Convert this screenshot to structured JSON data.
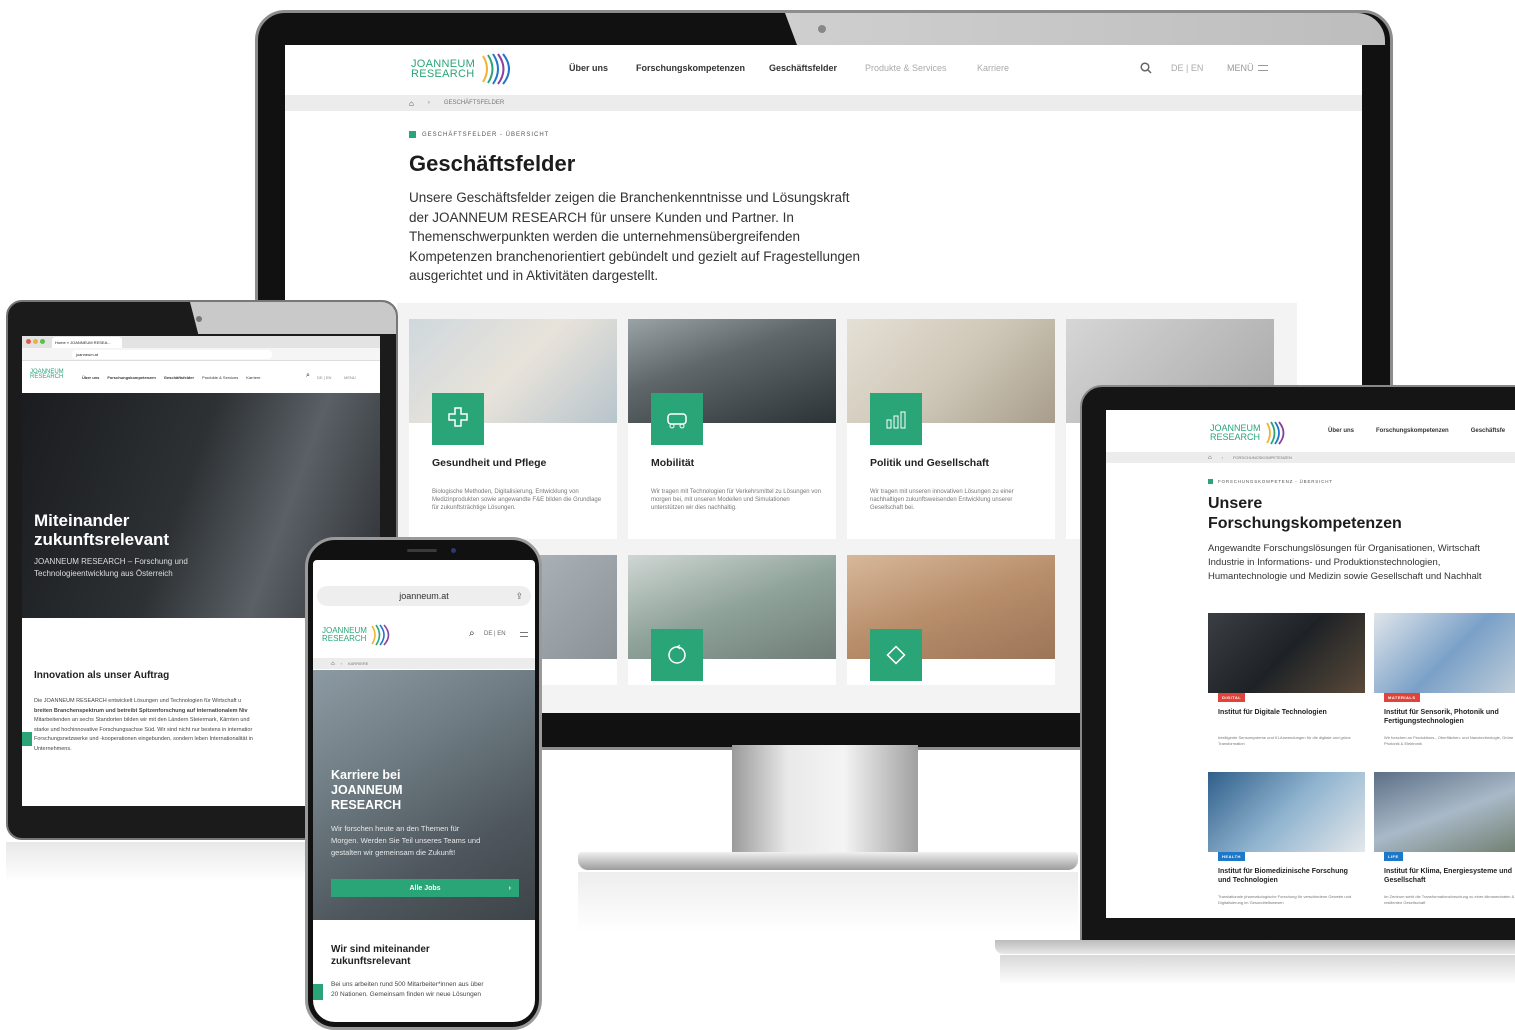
{
  "monitor": {
    "logo": {
      "line1": "JOANNEUM",
      "line2": "RESEARCH"
    },
    "nav": [
      "Über uns",
      "Forschungskompetenzen",
      "Geschäftsfelder",
      "Produkte & Services",
      "Karriere"
    ],
    "lang": "DE | EN",
    "menu": "MENÜ",
    "breadcrumb": "GESCHÄFTSFELDER",
    "eyebrow": "GESCHÄFTSFELDER - ÜBERSICHT",
    "title": "Geschäftsfelder",
    "intro_lines": [
      "Unsere Geschäftsfelder zeigen die Branchenkenntnisse und Lösungskraft",
      "der JOANNEUM RESEARCH für unsere Kunden und Partner. In",
      "Themenschwerpunkten werden die unternehmensübergreifenden",
      "Kompetenzen branchenorientiert gebündelt und gezielt auf Fragestellungen",
      "ausgerichtet und in Aktivitäten dargestellt."
    ],
    "cards": [
      {
        "title": "Gesundheit und Pflege",
        "icon": "health-care-icon",
        "text": "Biologische Methoden, Digitalisierung, Entwicklung von Medizinprodukten sowie angewandte F&E bilden die Grundlage für zukunftsträchtige Lösungen."
      },
      {
        "title": "Mobilität",
        "icon": "mobility-icon",
        "text": "Wir tragen mit Technologien für Verkehrsmittel zu Lösungen von morgen bei, mit unseren Modellen und Simulationen unterstützen wir dies nachhaltig."
      },
      {
        "title": "Politik und Gesellschaft",
        "icon": "policy-chart-icon",
        "text": "Wir tragen mit unseren innovativen Lösungen zu einer nachhaltigen zukunftsweisenden Entwicklung unserer Gesellschaft bei."
      }
    ]
  },
  "tablet": {
    "tab_title": "Home » JOANNEUM RESEA...",
    "url": "joanneum.at",
    "logo": {
      "line1": "JOANNEUM",
      "line2": "RESEARCH"
    },
    "nav": [
      "Über uns",
      "Forschungskompetenzen",
      "Geschäftsfelder",
      "Produkte & Services",
      "Karriere"
    ],
    "lang": "DE | EN",
    "menu": "MENÜ",
    "hero_title_1": "Miteinander",
    "hero_title_2": "zukunftsrelevant",
    "hero_sub_1": "JOANNEUM RESEARCH – Forschung und",
    "hero_sub_2": "Technologieentwicklung aus Österreich",
    "section_title": "Innovation als unser Auftrag",
    "body_lines": [
      "Die JOANNEUM RESEARCH entwickelt Lösungen und Technologien für Wirtschaft u",
      "breiten Branchenspektrum und betreibt Spitzenforschung auf internationalem Niv",
      "Mitarbeitenden an sechs Standorten bilden wir mit den Ländern Steiermark, Kärnten und",
      "starke und hochinnovative Forschungsachse Süd. Wir sind nicht nur bestens in internatior",
      "Forschungsnetzwerke und -kooperationen eingebunden, sondern leben Internationalität in",
      "Unternehmens."
    ]
  },
  "phone": {
    "url": "joanneum.at",
    "logo": {
      "line1": "JOANNEUM",
      "line2": "RESEARCH"
    },
    "lang": "DE | EN",
    "breadcrumb": "KARRIERE",
    "hero_title": [
      "Karriere bei",
      "JOANNEUM",
      "RESEARCH"
    ],
    "hero_text": [
      "Wir forschen heute an den Themen für",
      "Morgen. Werden Sie Teil unseres Teams und",
      "gestalten wir gemeinsam die Zukunft!"
    ],
    "button": "Alle Jobs",
    "section_title": [
      "Wir sind miteinander",
      "zukunftsrelevant"
    ],
    "body": [
      "Bei uns arbeiten rund 500 Mitarbeiter*innen aus über",
      "20 Nationen. Gemeinsam finden wir neue Lösungen"
    ]
  },
  "laptop": {
    "logo": {
      "line1": "JOANNEUM",
      "line2": "RESEARCH"
    },
    "nav": [
      "Über uns",
      "Forschungskompetenzen",
      "Geschäftsfe"
    ],
    "breadcrumb": "FORSCHUNGSKOMPETENZEN",
    "eyebrow": "FORSCHUNGSKOMPETENZ - ÜBERSICHT",
    "title_1": "Unsere",
    "title_2": "Forschungskompetenzen",
    "intro": [
      "Angewandte Forschungslösungen für Organisationen, Wirtschaft",
      "Industrie in Informations- und Produktionstechnologien,",
      "Humantechnologie und Medizin sowie Gesellschaft und Nachhalt"
    ],
    "cards": [
      {
        "badge": "DIGITAL",
        "title": "Institut für Digitale Technologien",
        "text": "Intelligente Sensorsysteme und KI-Anwendungen für die digitale und grüne Transformation"
      },
      {
        "badge": "MATERIALS",
        "title": "Institut für Sensorik, Photonik und Fertigungstechnologien",
        "text": "Wir forschen an Produktions-, Oberflächen- und Nanotechnologie, Grüne Photonik & Elektronik"
      },
      {
        "badge": "HEALTH",
        "title": "Institut für Biomedizinische Forschung und Technologien",
        "text": "Translationale pharmakologische Forschung für verschiedene Gewebe und Digitalisierung im Gesundheitswesen"
      },
      {
        "badge": "LIFE",
        "title": "Institut für Klima, Energiesysteme und Gesellschaft",
        "text": "Im Zentrum steht die Transformationsforschung zu einer klimaneutralen & resilienten Gesellschaft"
      }
    ]
  },
  "colors": {
    "accent": "#2aa577",
    "badge": "#e0433a",
    "badge_blue": "#1e78c8",
    "dark": "#1c1c1c"
  }
}
